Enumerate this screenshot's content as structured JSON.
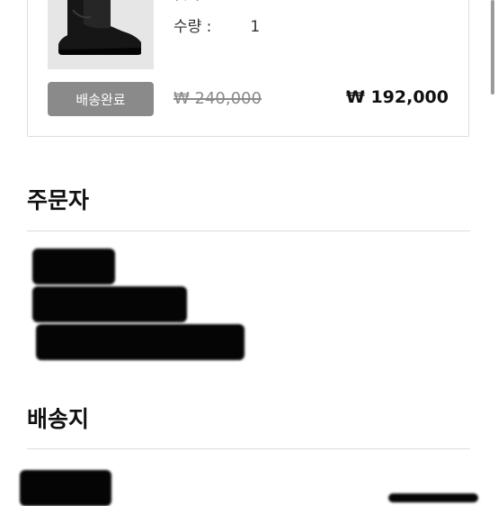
{
  "order_item": {
    "clipped_option_text": "( / )",
    "quantity_label": "수량 :",
    "quantity_value": "1",
    "status_badge": "배송완료",
    "original_price": "₩ 240,000",
    "final_price": "₩ 192,000"
  },
  "sections": {
    "orderer_title": "주문자",
    "shipping_title": "배송지"
  },
  "colors": {
    "badge_bg": "#8a8a8a",
    "divider": "#dcdcdc",
    "card_border": "#dedede"
  }
}
